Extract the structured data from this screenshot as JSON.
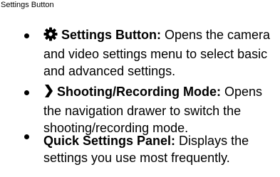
{
  "caption": {
    "partial_line": "",
    "label": "Settings Button"
  },
  "items": [
    {
      "icon": "gear-icon",
      "term": "Settings Button:",
      "description": " Opens the camera and video settings menu to select basic and advanced settings."
    },
    {
      "icon": "chevron-right-icon",
      "term": "Shooting/Recording Mode:",
      "description": " Opens the navigation drawer to switch the shooting/recording mode."
    },
    {
      "icon": "",
      "term": "Quick Settings Panel:",
      "description": " Displays the settings you use most frequently."
    }
  ]
}
